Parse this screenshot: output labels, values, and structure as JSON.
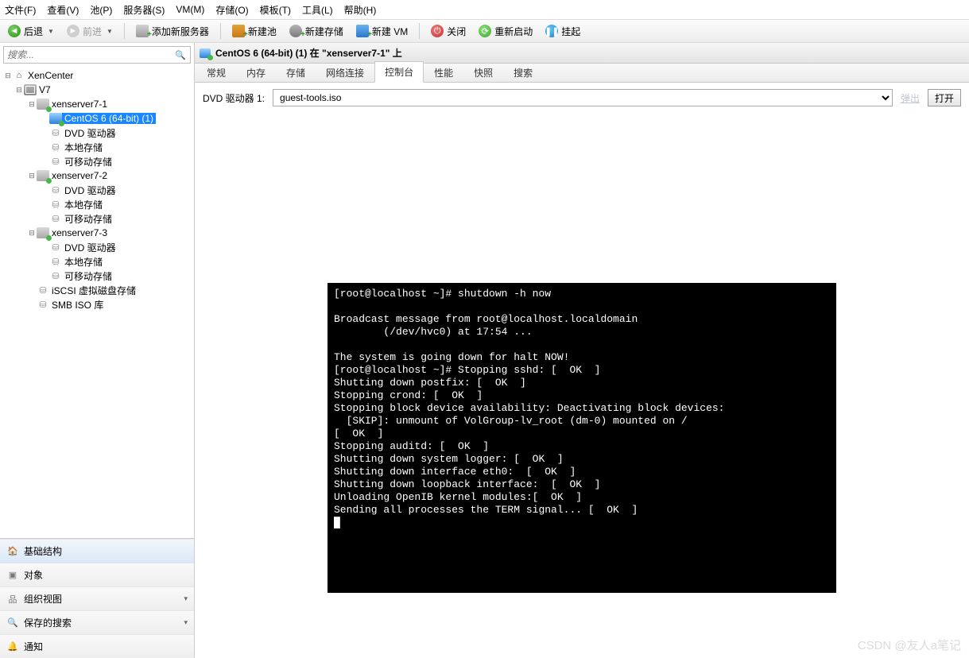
{
  "menu": [
    "文件(F)",
    "查看(V)",
    "池(P)",
    "服务器(S)",
    "VM(M)",
    "存储(O)",
    "模板(T)",
    "工具(L)",
    "帮助(H)"
  ],
  "toolbar": {
    "back": "后退",
    "forward": "前进",
    "addServer": "添加新服务器",
    "newPool": "新建池",
    "newStorage": "新建存储",
    "newVM": "新建 VM",
    "shutdown": "关闭",
    "reboot": "重新启动",
    "suspend": "挂起"
  },
  "search": {
    "placeholder": "搜索..."
  },
  "tree": {
    "root": "XenCenter",
    "pool": "V7",
    "hosts": [
      {
        "name": "xenserver7-1",
        "children": [
          {
            "name": "CentOS 6 (64-bit) (1)",
            "type": "vm",
            "selected": true
          },
          {
            "name": "DVD 驱动器",
            "type": "disk"
          },
          {
            "name": "本地存储",
            "type": "disk"
          },
          {
            "name": "可移动存储",
            "type": "disk"
          }
        ]
      },
      {
        "name": "xenserver7-2",
        "children": [
          {
            "name": "DVD 驱动器",
            "type": "disk"
          },
          {
            "name": "本地存储",
            "type": "disk"
          },
          {
            "name": "可移动存储",
            "type": "disk"
          }
        ]
      },
      {
        "name": "xenserver7-3",
        "children": [
          {
            "name": "DVD 驱动器",
            "type": "disk"
          },
          {
            "name": "本地存储",
            "type": "disk"
          },
          {
            "name": "可移动存储",
            "type": "disk"
          }
        ]
      }
    ],
    "extra": [
      {
        "name": "iSCSI 虚拟磁盘存储",
        "type": "disk"
      },
      {
        "name": "SMB ISO 库",
        "type": "disk"
      }
    ]
  },
  "bottomnav": {
    "items": [
      "基础结构",
      "对象",
      "组织视图",
      "保存的搜索",
      "通知"
    ]
  },
  "detail": {
    "title": "CentOS 6 (64-bit) (1) 在 \"xenserver7-1\" 上",
    "tabs": [
      "常规",
      "内存",
      "存储",
      "网络连接",
      "控制台",
      "性能",
      "快照",
      "搜索"
    ],
    "activeTabIndex": 4,
    "dvdLabel": "DVD 驱动器 1:",
    "dvdSelection": "guest-tools.iso",
    "ejectLabel": "弹出",
    "openLabel": "打开",
    "console": "[root@localhost ~]# shutdown -h now\n\nBroadcast message from root@localhost.localdomain\n        (/dev/hvc0) at 17:54 ...\n\nThe system is going down for halt NOW!\n[root@localhost ~]# Stopping sshd: [  OK  ]\nShutting down postfix: [  OK  ]\nStopping crond: [  OK  ]\nStopping block device availability: Deactivating block devices:\n  [SKIP]: unmount of VolGroup-lv_root (dm-0) mounted on /\n[  OK  ]\nStopping auditd: [  OK  ]\nShutting down system logger: [  OK  ]\nShutting down interface eth0:  [  OK  ]\nShutting down loopback interface:  [  OK  ]\nUnloading OpenIB kernel modules:[  OK  ]\nSending all processes the TERM signal... [  OK  ]\n█"
  },
  "watermark": "CSDN @友人a笔记"
}
